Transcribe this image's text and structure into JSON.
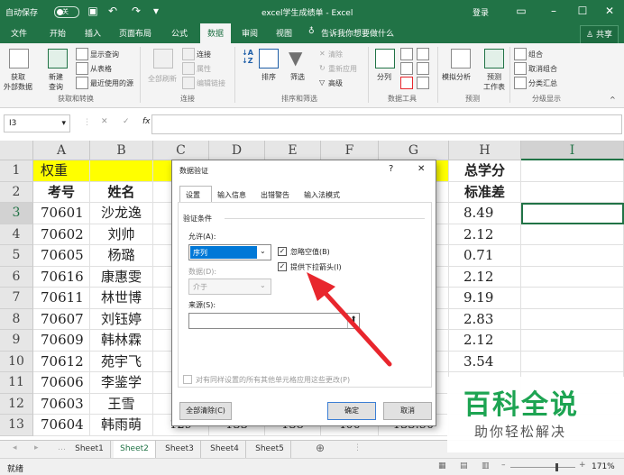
{
  "titlebar": {
    "autosave": "自动保存",
    "autosave_state": "关",
    "title": "excel学生成绩单 - Excel",
    "login": "登录"
  },
  "menu": {
    "tabs": [
      "文件",
      "开始",
      "插入",
      "页面布局",
      "公式",
      "数据",
      "审阅",
      "视图"
    ],
    "active": "数据",
    "tell_me": "告诉我你想要做什么",
    "share": "共享"
  },
  "ribbon": {
    "get_external": "获取\n外部数据",
    "new_query": "新建\n查询",
    "show_queries": "显示查询",
    "from_table": "从表格",
    "recent_sources": "最近使用的源",
    "group_get": "获取和转换",
    "refresh_all": "全部刷新",
    "connections": "连接",
    "properties": "属性",
    "edit_links": "编辑链接",
    "group_conn": "连接",
    "sort": "排序",
    "filter": "筛选",
    "clear": "清除",
    "reapply": "重新应用",
    "advanced": "高级",
    "group_sort": "排序和筛选",
    "text_to_cols": "分列",
    "group_tools": "数据工具",
    "whatif": "模拟分析",
    "forecast_sheet": "预测\n工作表",
    "group_forecast": "预测",
    "group_btn": "组合",
    "ungroup_btn": "取消组合",
    "subtotal": "分类汇总",
    "group_outline": "分级显示"
  },
  "formula_bar": {
    "name_box": "I3",
    "fx": "fx",
    "value": ""
  },
  "grid": {
    "columns": [
      "A",
      "B",
      "C",
      "D",
      "E",
      "F",
      "G",
      "H",
      "I"
    ],
    "rows": [
      "1",
      "2",
      "3",
      "4",
      "5",
      "6",
      "7",
      "8",
      "9",
      "10",
      "11",
      "12",
      "13"
    ],
    "row1_a": "权重",
    "row1_h": "总学分",
    "header": {
      "a": "考号",
      "b": "姓名",
      "c": "语",
      "h": "标准差"
    },
    "ids": [
      "70601",
      "70602",
      "70605",
      "70616",
      "70611",
      "70607",
      "70609",
      "70612",
      "70606",
      "70603",
      "70604"
    ],
    "names": [
      "沙龙逸",
      "刘帅",
      "杨璐",
      "康惠雯",
      "林世博",
      "刘钰婷",
      "韩林霖",
      "苑宇飞",
      "李鉴学",
      "王雪",
      "韩雨萌"
    ],
    "stddev": [
      "8.49",
      "2.12",
      "0.71",
      "2.12",
      "9.19",
      "2.83",
      "2.12",
      "3.54"
    ],
    "row13_partial": [
      "129",
      "133",
      "138",
      "400",
      "133.50"
    ]
  },
  "sheets": {
    "tabs": [
      "Sheet1",
      "Sheet2",
      "Sheet3",
      "Sheet4",
      "Sheet5"
    ],
    "active": "Sheet2"
  },
  "status": {
    "ready": "就绪",
    "zoom": "171%"
  },
  "dialog": {
    "title": "数据验证",
    "help": "?",
    "close": "✕",
    "tabs": [
      "设置",
      "输入信息",
      "出错警告",
      "输入法模式"
    ],
    "active_tab": "设置",
    "criteria_label": "验证条件",
    "allow_label": "允许(A):",
    "allow_value": "序列",
    "ignore_blank": "忽略空值(B)",
    "ignore_blank_checked": true,
    "dropdown_arrow": "提供下拉箭头(I)",
    "dropdown_arrow_checked": true,
    "data_label": "数据(D):",
    "data_value": "介于",
    "source_label": "来源(S):",
    "source_value": "",
    "apply_all": "对有同样设置的所有其他单元格应用这些更改(P)",
    "clear_all": "全部清除(C)",
    "ok": "确定",
    "cancel": "取消"
  },
  "watermark": {
    "title": "百科全说",
    "subtitle": "助你轻松解决"
  },
  "colors": {
    "excel_green": "#217346",
    "highlight_yellow": "#ffff00",
    "arrow_red": "#e8262d",
    "watermark_green": "#1da452"
  }
}
